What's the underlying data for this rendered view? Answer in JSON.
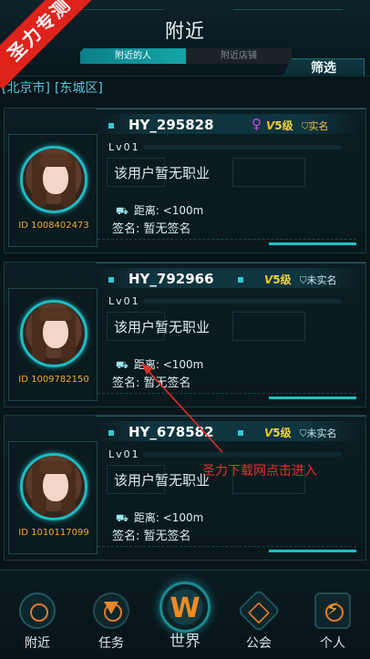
{
  "watermark": "圣力专测",
  "header": {
    "title": "附近",
    "tabs": [
      {
        "label": "附近的人",
        "active": true
      },
      {
        "label": "附近店铺",
        "active": false
      }
    ],
    "filter_label": "筛选"
  },
  "location": {
    "city": "[北京市]",
    "district": "[东城区]"
  },
  "cards": [
    {
      "username": "HY_295828",
      "gender_icon": "♀",
      "level_v": "V",
      "level_text": "5级",
      "verified_icon": "shield-icon",
      "verified_label": "实名",
      "verified": true,
      "lv_label": "Lv01",
      "lv_progress": 0.0,
      "occupation": "该用户暂无职业",
      "distance": "距离: <100m",
      "signature": "签名: 暂无签名",
      "uid": "ID 1008402473"
    },
    {
      "username": "HY_792966",
      "gender_icon": "",
      "level_v": "V",
      "level_text": "5级",
      "verified_icon": "shield-icon",
      "verified_label": "未实名",
      "verified": false,
      "lv_label": "Lv01",
      "lv_progress": 0.0,
      "occupation": "该用户暂无职业",
      "distance": "距离: <100m",
      "signature": "签名: 暂无签名",
      "uid": "ID 1009782150"
    },
    {
      "username": "HY_678582",
      "gender_icon": "",
      "level_v": "V",
      "level_text": "5级",
      "verified_icon": "shield-icon",
      "verified_label": "未实名",
      "verified": false,
      "lv_label": "Lv01",
      "lv_progress": 0.0,
      "occupation": "该用户暂无职业",
      "distance": "距离: <100m",
      "signature": "签名: 暂无签名",
      "uid": "ID 1010117099"
    }
  ],
  "annotation": "圣力下载网点击进入",
  "bottom_nav": [
    {
      "label": "附近",
      "icon": "radar-icon"
    },
    {
      "label": "任务",
      "icon": "triangle-task-icon"
    },
    {
      "label": "世界",
      "icon": "w-logo-icon",
      "glyph": "W"
    },
    {
      "label": "公会",
      "icon": "guild-icon"
    },
    {
      "label": "个人",
      "icon": "bolt-profile-icon",
      "glyph": "⚡"
    }
  ],
  "colors": {
    "accent": "#17c3c6",
    "background": "#071418",
    "gold": "#f3c33b",
    "orange": "#f08a22",
    "female": "#c24bde",
    "annotation_red": "#e23127"
  }
}
